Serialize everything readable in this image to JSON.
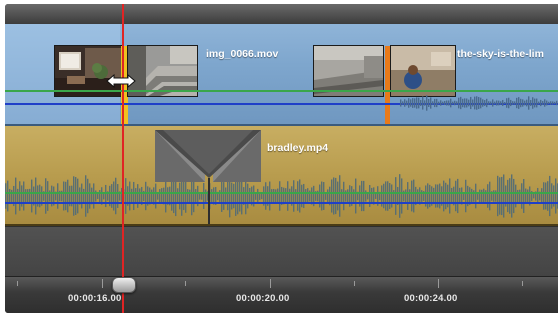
{
  "timeline": {
    "video_track": {
      "clips": [
        {
          "label": "img_0066.mov",
          "thumbnails": [
            "room-interior-thumbnail",
            "stone-steps-thumbnail"
          ]
        },
        {
          "label": "the-sky-is-the-lim",
          "thumbnails": [
            "stone-steps-thumbnail",
            "person-by-wall-thumbnail"
          ]
        }
      ]
    },
    "audio_track": {
      "clip_label": "bradley.mp4"
    },
    "ruler": {
      "timecodes": [
        "00:00:16.00",
        "00:00:20.00",
        "00:00:24.00"
      ]
    },
    "playhead": {
      "position_timecode": "00:00:16.00"
    }
  },
  "colors": {
    "video_track": "#7ea6cd",
    "audio_track": "#b89c4e",
    "playhead": "#e02424",
    "audio_level_line": "#1f3fc8",
    "volume_line": "#3aa64a",
    "clip_edge_yellow": "#f0c020",
    "clip_edge_orange": "#e87a1a"
  }
}
